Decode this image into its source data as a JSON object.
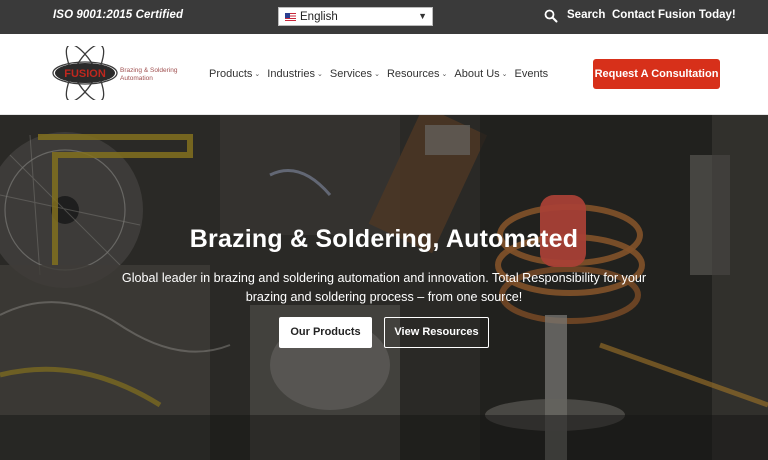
{
  "topbar": {
    "certification": "ISO 9001:2015 Certified",
    "language": "English",
    "search_label": "Search",
    "contact_label": "Contact Fusion Today!"
  },
  "header": {
    "logo_text": "FUSION",
    "tagline": "Brazing & Soldering Automation",
    "nav": [
      {
        "label": "Products",
        "has_dropdown": true
      },
      {
        "label": "Industries",
        "has_dropdown": true
      },
      {
        "label": "Services",
        "has_dropdown": true
      },
      {
        "label": "Resources",
        "has_dropdown": true
      },
      {
        "label": "About Us",
        "has_dropdown": true
      },
      {
        "label": "Events",
        "has_dropdown": false
      }
    ],
    "cta_label": "Request A Consultation"
  },
  "hero": {
    "title": "Brazing & Soldering, Automated",
    "subtitle": "Global leader in brazing and soldering automation and innovation. Total Responsibility for your brazing and soldering process – from one source!",
    "primary_button": "Our Products",
    "secondary_button": "View Resources"
  },
  "colors": {
    "topbar_bg": "#3a3a3a",
    "accent": "#d7301a",
    "logo_red": "#c0271e"
  },
  "icons": {
    "search": "search-icon",
    "flag": "us-flag-icon",
    "caret": "caret-down-icon",
    "chevron": "chevron-down-icon"
  }
}
